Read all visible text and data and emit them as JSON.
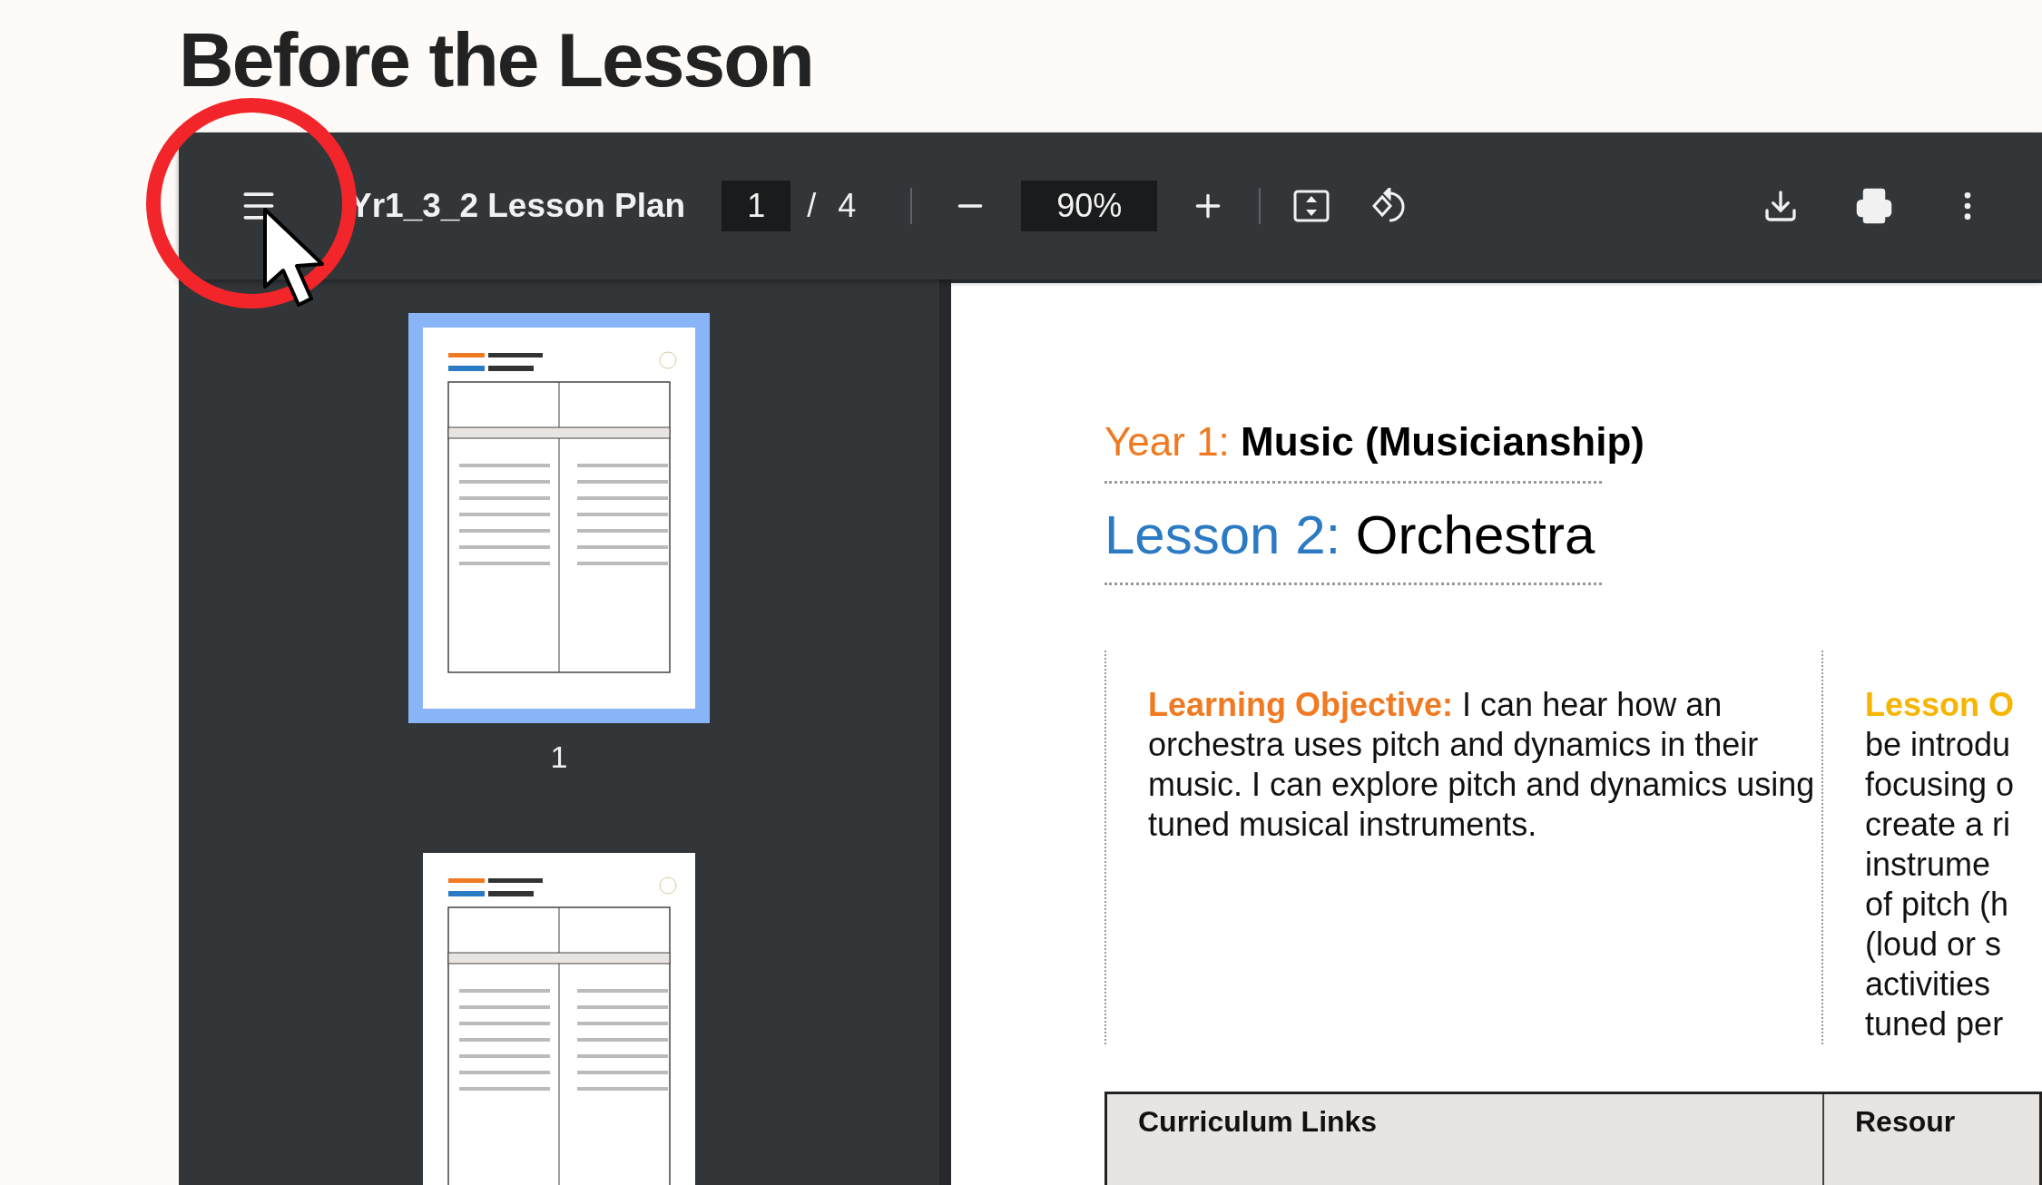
{
  "heading": "Before the Lesson",
  "toolbar": {
    "title": "Yr1_3_2 Lesson Plan",
    "page": "1",
    "page_total": "/ 4",
    "zoom": "90%"
  },
  "thumbnails": [
    {
      "label": "1",
      "selected": true
    },
    {
      "selected": false
    }
  ],
  "document": {
    "subject_label": "Year 1:",
    "subject": "Music (Musicianship)",
    "lesson_label": "Lesson 2:",
    "lesson": "Orchestra",
    "columns": [
      {
        "kind": "objective",
        "label": "Learning Objective:",
        "text": "I can hear how an orchestra uses pitch and dynamics in their music. I can explore pitch and dynamics using tuned musical instruments."
      },
      {
        "kind": "overview",
        "label": "Lesson O",
        "lines": [
          "be introdu",
          "focusing o",
          "create a ri",
          "instrume",
          "of pitch (h",
          "(loud or s",
          "activities",
          "tuned per"
        ]
      }
    ],
    "table_headers": [
      "Curriculum Links",
      "Resour"
    ]
  }
}
